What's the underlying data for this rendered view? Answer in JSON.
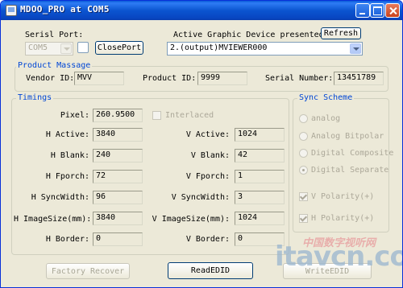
{
  "window": {
    "title": "MDOO_PRO at COM5"
  },
  "top": {
    "serial_port_label": "Serisl Port:",
    "serial_port_value": "COM5",
    "close_port_button": "ClosePort",
    "active_device_label": "Active Graphic Device presented",
    "refresh_button": "Refresh",
    "device_value": "2.(output)MVIEWER000"
  },
  "product": {
    "legend": "Product Massage",
    "vendor_id_label": "Vendor ID:",
    "vendor_id_value": "MVV",
    "product_id_label": "Product ID:",
    "product_id_value": "9999",
    "serial_number_label": "Serial Number:",
    "serial_number_value": "13451789"
  },
  "timings": {
    "legend": "Timings",
    "pixel_label": "Pixel:",
    "pixel_value": "260.9500",
    "interlaced_label": "Interlaced",
    "h_active_label": "H Active:",
    "h_active_value": "3840",
    "v_active_label": "V Active:",
    "v_active_value": "1024",
    "h_blank_label": "H Blank:",
    "h_blank_value": "240",
    "v_blank_label": "V Blank:",
    "v_blank_value": "42",
    "h_fporch_label": "H Fporch:",
    "h_fporch_value": "72",
    "v_fporch_label": "V Fporch:",
    "v_fporch_value": "1",
    "h_syncwidth_label": "H SyncWidth:",
    "h_syncwidth_value": "96",
    "v_syncwidth_label": "V SyncWidth:",
    "v_syncwidth_value": "3",
    "h_imagesize_label": "H ImageSize(mm):",
    "h_imagesize_value": "3840",
    "v_imagesize_label": "V ImageSize(mm):",
    "v_imagesize_value": "1024",
    "h_border_label": "H Border:",
    "h_border_value": "0",
    "v_border_label": "V Border:",
    "v_border_value": "0"
  },
  "sync": {
    "legend": "Sync Scheme",
    "analog": "analog",
    "analog_bipolar": "Analog Bitpolar",
    "digital_composite": "Digital Composite",
    "digital_separate": "Digital Separate",
    "v_polarity": "V Polarity(+)",
    "h_polarity": "H Polarity(+)"
  },
  "buttons": {
    "factory_recover": "Factory Recover",
    "read_edid": "ReadEDID",
    "write_edid": "WriteEDID"
  },
  "watermark": {
    "cn": "中国数字视听网",
    "en": "itavcn.com"
  }
}
